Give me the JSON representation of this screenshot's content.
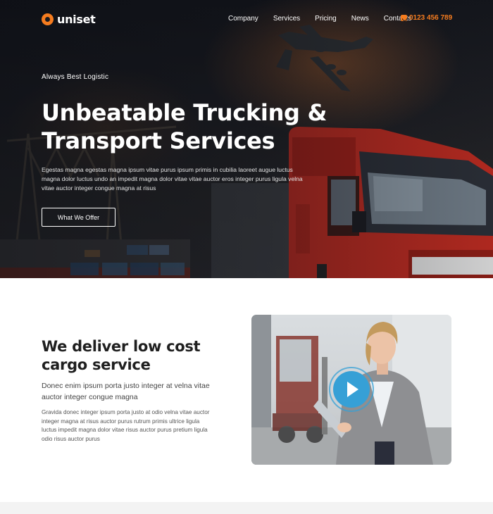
{
  "nav": {
    "brand": "uniset",
    "items": [
      "Company",
      "Services",
      "Pricing",
      "News",
      "Contacts"
    ],
    "phone": "0123 456 789"
  },
  "hero": {
    "eyebrow": "Always Best Logistic",
    "title_line1": "Unbeatable Trucking &",
    "title_line2": "Transport Services",
    "text": "Egestas magna egestas magna ipsum vitae purus ipsum primis in cubilia laoreet augue luctus magna dolor luctus undo an impedit magna dolor vitae vitae auctor eros integer purus ligula velna vitae auctor integer congue magna at risus",
    "button": "What We Offer"
  },
  "feature": {
    "title": "We deliver low cost cargo service",
    "lead": "Donec enim ipsum porta justo integer at velna vitae auctor integer congue magna",
    "body": "Gravida donec integer ipsum porta justo at odio velna vitae auctor integer magna at risus auctor purus rutrum primis ultrice ligula luctus impedit magna dolor vitae risus auctor purus pretium ligula odio risus auctor purus"
  },
  "colors": {
    "accent": "#f57c1f",
    "play": "#36a0d6",
    "dark": "#1a1b20"
  }
}
